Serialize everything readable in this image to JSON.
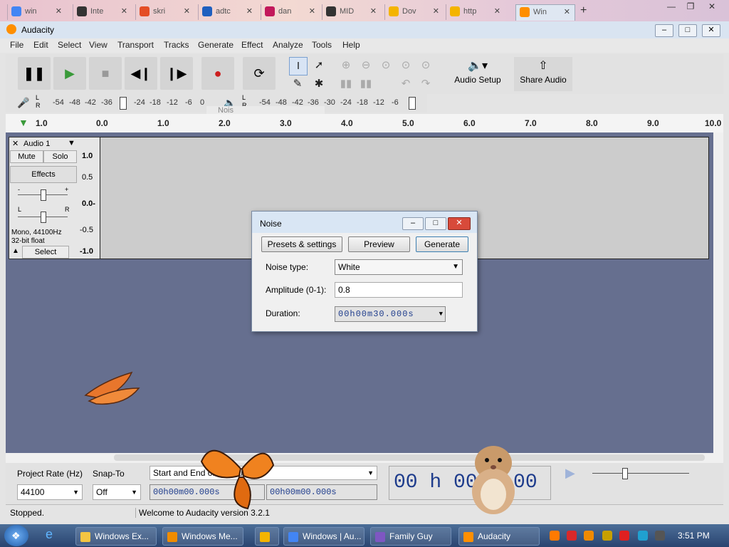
{
  "browser_tabs": [
    {
      "label": "win",
      "color": "#4285f4",
      "active": false
    },
    {
      "label": "Inte",
      "color": "#333333",
      "active": false
    },
    {
      "label": "skri",
      "color": "#e44d26",
      "active": false
    },
    {
      "label": "adtc",
      "color": "#1f5fbf",
      "active": false
    },
    {
      "label": "dan",
      "color": "#c2185b",
      "active": false
    },
    {
      "label": "MID",
      "color": "#333333",
      "active": false
    },
    {
      "label": "Dov",
      "color": "#f4b400",
      "active": false
    },
    {
      "label": "http",
      "color": "#f4b400",
      "active": false
    },
    {
      "label": "Win",
      "color": "#ff8f00",
      "active": true
    }
  ],
  "window": {
    "title": "Audacity"
  },
  "menu": [
    "File",
    "Edit",
    "Select",
    "View",
    "Transport",
    "Tracks",
    "Generate",
    "Effect",
    "Analyze",
    "Tools",
    "Help"
  ],
  "toolbar": {
    "audio_setup": "Audio Setup",
    "share_audio": "Share Audio"
  },
  "meters": {
    "rec_lr": "L\nR",
    "rec_ticks": [
      "-54",
      "-48",
      "-42",
      "-36",
      "-24",
      "-18",
      "-12",
      "-6",
      "0"
    ],
    "play_ticks": [
      "-54",
      "-48",
      "-42",
      "-36",
      "-30",
      "-24",
      "-18",
      "-12",
      "-6",
      "0"
    ],
    "tooltip": "Nois"
  },
  "ruler": [
    "1.0",
    "0.0",
    "1.0",
    "2.0",
    "3.0",
    "4.0",
    "5.0",
    "6.0",
    "7.0",
    "8.0",
    "9.0",
    "10.0"
  ],
  "track": {
    "name": "Audio 1",
    "mute": "Mute",
    "solo": "Solo",
    "effects": "Effects",
    "gain_minus": "-",
    "gain_plus": "+",
    "pan_l": "L",
    "pan_r": "R",
    "info1": "Mono, 44100Hz",
    "info2": "32-bit float",
    "select": "Select",
    "scale": [
      "1.0",
      "0.5",
      "0.0-",
      "-0.5",
      "-1.0"
    ]
  },
  "dialog": {
    "title": "Noise",
    "presets": "Presets & settings",
    "preview": "Preview",
    "generate": "Generate",
    "noise_type_label": "Noise type:",
    "noise_type_value": "White",
    "amplitude_label": "Amplitude (0-1):",
    "amplitude_value": "0.8",
    "duration_label": "Duration:",
    "duration_value": "00h00m30.000s"
  },
  "selection": {
    "project_rate_label": "Project Rate (Hz)",
    "project_rate_value": "44100",
    "snap_label": "Snap-To",
    "snap_value": "Off",
    "sel_mode": "Start and End of Selectio",
    "start_time": "00h00m00.000s",
    "end_time": "00h00m00.000s",
    "big_time": "00 h 00 m 00 s"
  },
  "status": {
    "state": "Stopped.",
    "welcome": "Welcome to Audacity version 3.2.1"
  },
  "taskbar": {
    "items": [
      {
        "label": "Windows Ex...",
        "color": "#f4c542"
      },
      {
        "label": "Windows Me...",
        "color": "#f08c00"
      },
      {
        "label": "",
        "color": "#f4b400"
      },
      {
        "label": "Windows | Au...",
        "color": "#4285f4"
      },
      {
        "label": "Family Guy",
        "color": "#7e57c2"
      },
      {
        "label": "Audacity",
        "color": "#ff8f00"
      }
    ],
    "clock": "3:51 PM"
  }
}
